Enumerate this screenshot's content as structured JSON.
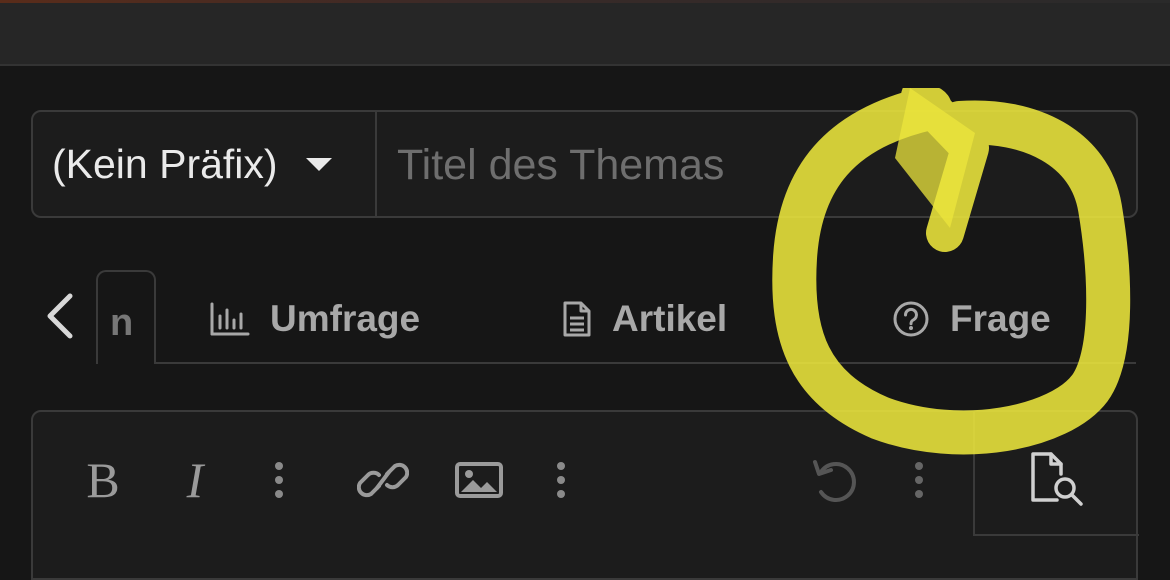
{
  "prefix": {
    "label": "(Kein Präfix)"
  },
  "title": {
    "placeholder": "Titel des Themas",
    "value": ""
  },
  "tabs": {
    "active_fragment": "n",
    "items": [
      {
        "label": "Umfrage",
        "icon": "poll-chart-icon"
      },
      {
        "label": "Artikel",
        "icon": "document-icon"
      },
      {
        "label": "Frage",
        "icon": "question-circle-icon"
      }
    ]
  },
  "toolbar": {
    "bold": "B",
    "italic": "I",
    "icons": [
      "more-options-icon",
      "link-icon",
      "image-icon",
      "more-options-icon",
      "undo-icon",
      "more-options-icon",
      "preview-icon"
    ]
  },
  "colors": {
    "background": "#161616",
    "topbar": "#262626",
    "border": "#3a3a3a",
    "text": "#eaeaea",
    "muted": "#a8a8a8",
    "annotation": "#ece63c"
  }
}
